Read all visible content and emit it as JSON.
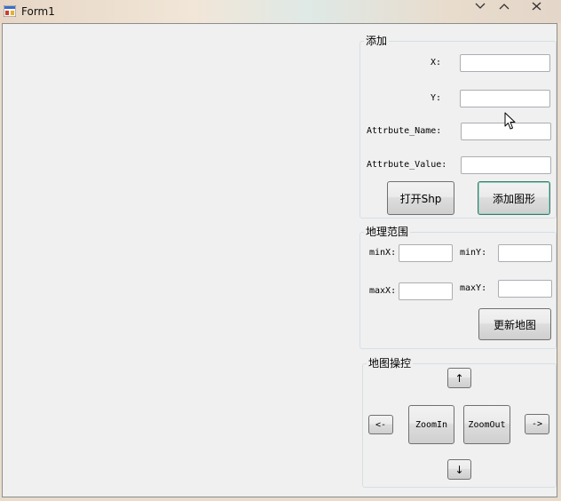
{
  "window": {
    "title": "Form1",
    "icon": "winforms-app-icon",
    "controls": [
      "minimize-icon",
      "maximize-icon",
      "close-icon"
    ]
  },
  "add_group": {
    "title": "添加",
    "x_label": "X:",
    "x_value": "",
    "y_label": "Y:",
    "y_value": "",
    "attr_name_label": "Attrbute_Name:",
    "attr_name_value": "",
    "attr_value_label": "Attrbute_Value:",
    "attr_value_value": "",
    "open_shp_button": "打开Shp",
    "add_shape_button": "添加图形"
  },
  "extent_group": {
    "title": "地理范围",
    "minx_label": "minX:",
    "minx_value": "",
    "miny_label": "minY:",
    "miny_value": "",
    "maxx_label": "maxX:",
    "maxx_value": "",
    "maxy_label": "maxY:",
    "maxy_value": "",
    "update_map_button": "更新地图"
  },
  "control_group": {
    "title": "地图操控",
    "up_button": "↑",
    "left_button": "<-",
    "zoom_in_button": "ZoomIn",
    "zoom_out_button": "ZoomOut",
    "right_button": "->",
    "down_button": "↓"
  },
  "colors": {
    "client_bg": "#f0f0f0",
    "group_border": "#d5dfe5",
    "button_border": "#707070",
    "focus_border": "#3d7a6a"
  }
}
